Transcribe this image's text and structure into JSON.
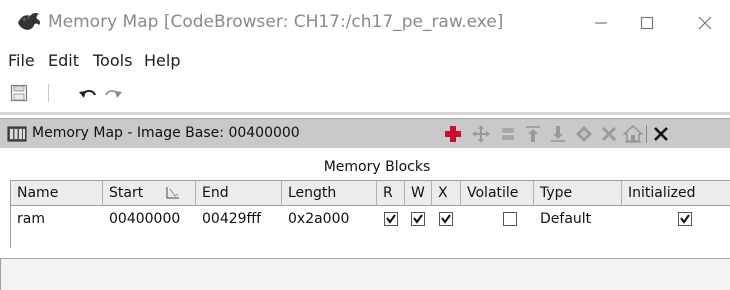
{
  "window": {
    "title": "Memory Map [CodeBrowser: CH17:/ch17_pe_raw.exe]",
    "controls": {
      "minimize": "minimize",
      "maximize": "maximize",
      "close": "close"
    }
  },
  "menu": {
    "file": "File",
    "edit": "Edit",
    "tools": "Tools",
    "help": "Help"
  },
  "toolbar": {
    "icons": [
      "save-icon",
      "undo-icon",
      "redo-icon"
    ]
  },
  "provider": {
    "title": "Memory Map - Image Base: 00400000",
    "actions": [
      "add-block-icon",
      "move-block-icon",
      "split-block-icon",
      "expand-up-icon",
      "expand-down-icon",
      "merge-blocks-icon",
      "delete-block-icon",
      "set-image-base-icon",
      "close-icon"
    ]
  },
  "section": {
    "title": "Memory Blocks"
  },
  "table": {
    "columns": [
      "Name",
      "Start",
      "End",
      "Length",
      "R",
      "W",
      "X",
      "Volatile",
      "Type",
      "Initialized"
    ],
    "rows": [
      {
        "name": "ram",
        "start": "00400000",
        "end": "00429fff",
        "length": "0x2a000",
        "r": true,
        "w": true,
        "x": true,
        "volatile": false,
        "type": "Default",
        "initialized": true
      }
    ]
  },
  "colors": {
    "header_bg": "#c9c9c9",
    "table_header_bg": "#ececec",
    "accent_red": "#c8102e",
    "icon_gray": "#9a9a9a"
  }
}
